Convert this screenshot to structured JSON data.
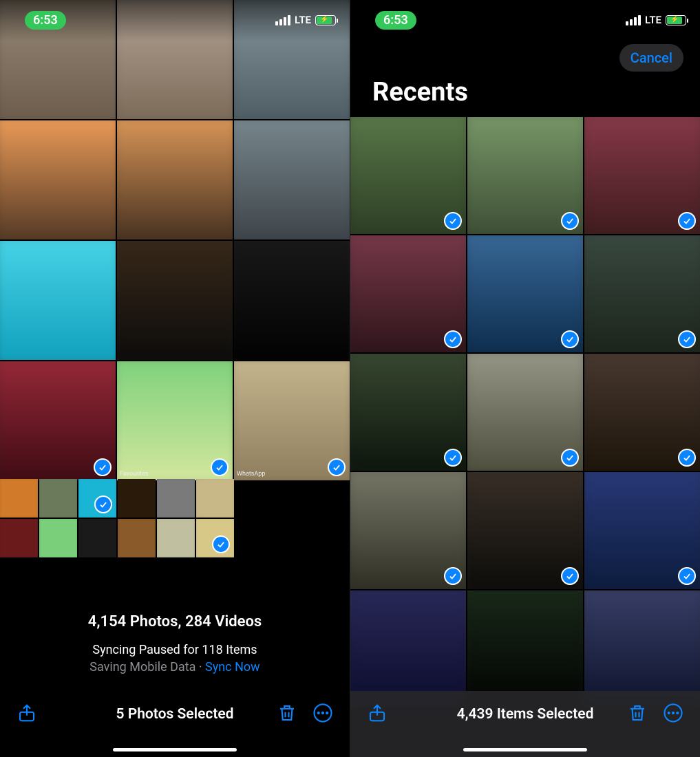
{
  "status": {
    "time": "6:53",
    "network_label": "LTE"
  },
  "left": {
    "summary": {
      "counts": "4,154 Photos, 284 Videos",
      "sync_status": "Syncing Paused for 118 Items",
      "saving_prefix": "Saving Mobile Data · ",
      "sync_action": "Sync Now"
    },
    "toolbar": {
      "selected": "5 Photos Selected"
    },
    "big_grid": {
      "selected_indices": [
        9,
        10,
        11
      ],
      "labels": {
        "10": "Favourites",
        "11": "WhatsApp"
      }
    },
    "small_grid": {
      "selected_indices": [
        2,
        11
      ]
    }
  },
  "right": {
    "cancel": "Cancel",
    "title": "Recents",
    "toolbar": {
      "selected": "4,439 Items Selected"
    },
    "grid": {
      "selected_indices": [
        0,
        1,
        2,
        3,
        4,
        5,
        6,
        7,
        8,
        9,
        10,
        11
      ]
    }
  }
}
